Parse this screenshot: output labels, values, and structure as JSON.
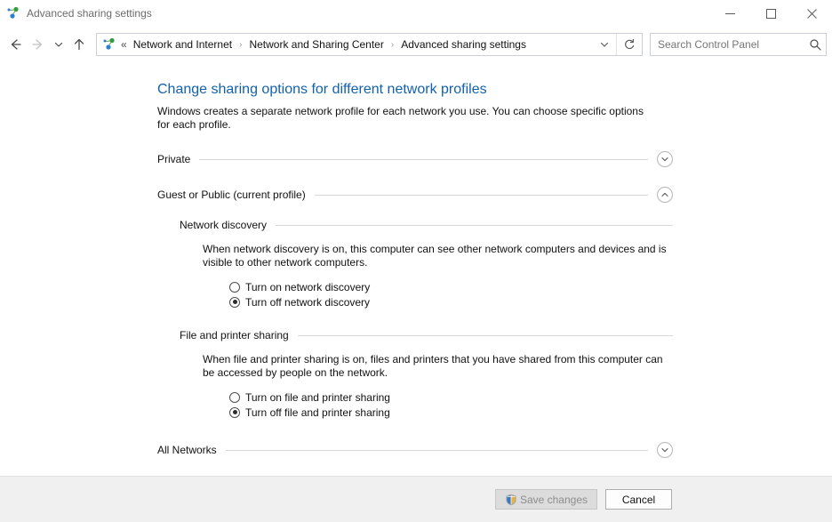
{
  "window": {
    "title": "Advanced sharing settings",
    "icon": "network-sharing-icon",
    "controls": {
      "minimize": "minimize-icon",
      "maximize": "maximize-icon",
      "close": "close-icon"
    }
  },
  "nav": {
    "back": "back-arrow-icon",
    "forward": "forward-arrow-icon",
    "recent": "recent-pages-chevron-icon",
    "up": "up-arrow-icon",
    "address": {
      "icon": "network-sharing-icon",
      "overflow": "«",
      "crumbs": [
        "Network and Internet",
        "Network and Sharing Center",
        "Advanced sharing settings"
      ],
      "separator": "›",
      "dropdown": "chevron-down-icon",
      "refresh": "refresh-icon"
    },
    "search": {
      "placeholder": "Search Control Panel",
      "value": "",
      "icon": "search-icon"
    }
  },
  "main": {
    "title": "Change sharing options for different network profiles",
    "description": "Windows creates a separate network profile for each network you use. You can choose specific options for each profile.",
    "profiles": [
      {
        "label": "Private",
        "expanded": false,
        "toggle_icon": "chevron-down-circle-icon"
      },
      {
        "label": "Guest or Public (current profile)",
        "expanded": true,
        "toggle_icon": "chevron-up-circle-icon"
      },
      {
        "label": "All Networks",
        "expanded": false,
        "toggle_icon": "chevron-down-circle-icon"
      }
    ],
    "sections": [
      {
        "label": "Network discovery",
        "description": "When network discovery is on, this computer can see other network computers and devices and is visible to other network computers.",
        "options": [
          {
            "label": "Turn on network discovery",
            "selected": false
          },
          {
            "label": "Turn off network discovery",
            "selected": true
          }
        ]
      },
      {
        "label": "File and printer sharing",
        "description": "When file and printer sharing is on, files and printers that you have shared from this computer can be accessed by people on the network.",
        "options": [
          {
            "label": "Turn on file and printer sharing",
            "selected": false
          },
          {
            "label": "Turn off file and printer sharing",
            "selected": true
          }
        ]
      }
    ]
  },
  "footer": {
    "save": {
      "label": "Save changes",
      "disabled": true,
      "icon": "uac-shield-icon"
    },
    "cancel": {
      "label": "Cancel",
      "disabled": false
    }
  },
  "colors": {
    "heading": "#1361ad",
    "rule": "#d8d8d8",
    "footer_bg": "#f0f0f0",
    "shield_blue": "#3a76c6",
    "shield_gold": "#e8b33c"
  }
}
